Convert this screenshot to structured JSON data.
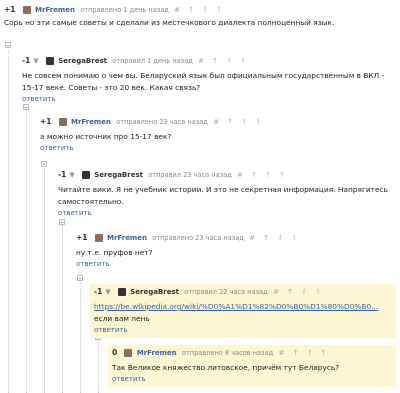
{
  "comments": [
    {
      "vote": "+1",
      "user": "MrFremen",
      "meta": "отправлено 1 день назад",
      "tools": "# ↑ ↾ ↿",
      "text": "Сорь но эти самые советы и сделали из местечкового диалекта полноценный язык.",
      "reply": ""
    },
    {
      "vote": "-1",
      "user": "SeregaBrest",
      "meta": "отправил 1 день назад",
      "tools": "# ↑ ↾ ↿",
      "text": "Не совсем понимаю о чем вы. Беларуский язык был официальным государственным в ВКЛ - 15-17 веке. Советы - это 20 век. Какая связь?",
      "reply": "ответить"
    },
    {
      "vote": "+1",
      "user": "MrFremen",
      "meta": "отправлено 23 часа назад",
      "tools": "# ↑ ↾ ↿",
      "text": "а можно источник про 15-17 век?",
      "reply": "ответить"
    },
    {
      "vote": "-1",
      "user": "SeregaBrest",
      "meta": "отправил 23 часа назад",
      "tools": "# ↑ ↾ ↿",
      "text": "Читайте вики. Я не учебник истории. И это не секретная информация. Напрягитесь самостоятельно.",
      "reply": "ответить"
    },
    {
      "vote": "+1",
      "user": "MrFremen",
      "meta": "отправлено 23 часа назад",
      "tools": "# ↑ ↾ ↿",
      "text": "ну т.е. пруфов нет?",
      "reply": "ответить"
    },
    {
      "vote": "-1",
      "user": "SeregaBrest",
      "meta": "отправил 22 часа назад",
      "tools": "# ↑ ↾ ↿",
      "link": "https://be.wikipedia.org/wiki/%D0%A1%D1%82%D0%B0%D1%80%D0%B0...",
      "text": "если вам лень",
      "reply": "ответить"
    },
    {
      "vote": "0",
      "user": "MrFremen",
      "meta": "отправлено 8 часов назад",
      "tools": "# ↑ ↾ ↿",
      "text": "Так Великое княжество литовское, причём тут Беларусь?",
      "reply": "ответить"
    }
  ],
  "vote_arrow": "▼",
  "colors": {
    "link": "#3b63a8",
    "highlight": "#fdf6d3",
    "meta": "#888888"
  }
}
